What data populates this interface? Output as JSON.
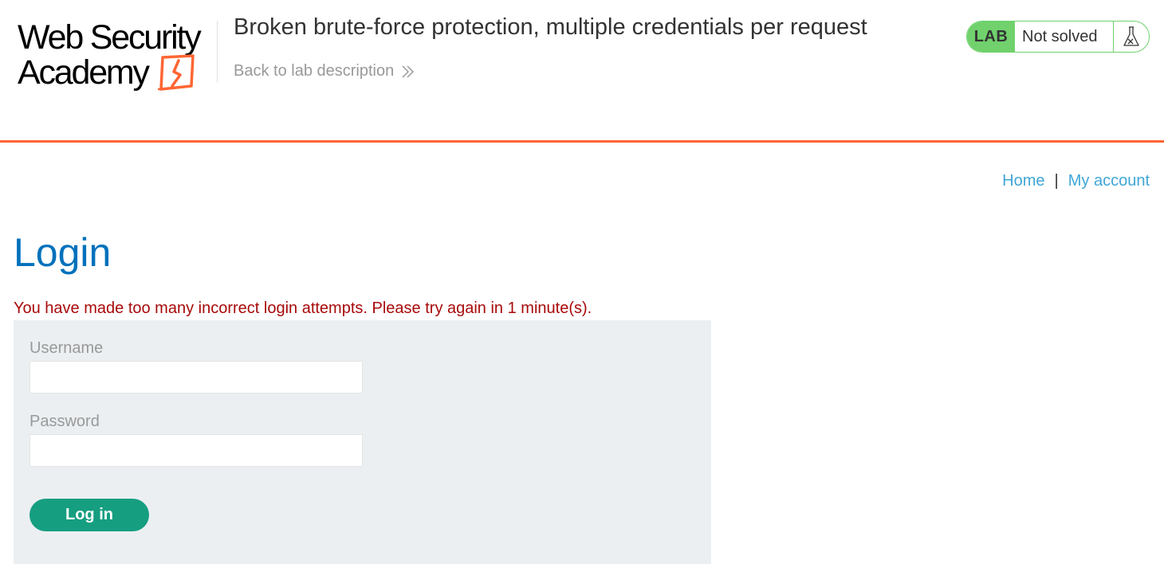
{
  "header": {
    "logo": {
      "line1": "Web Security",
      "line2": "Academy"
    },
    "lab_title": "Broken brute-force protection, multiple credentials per request",
    "back_link": "Back to lab description",
    "lab_status": {
      "badge": "LAB",
      "state": "Not solved"
    }
  },
  "nav": {
    "home": "Home",
    "separator": "|",
    "my_account": "My account"
  },
  "login": {
    "title": "Login",
    "error": "You have made too many incorrect login attempts. Please try again in 1 minute(s).",
    "username_label": "Username",
    "username_value": "",
    "password_label": "Password",
    "password_value": "",
    "submit_label": "Log in"
  },
  "colors": {
    "accent_orange": "#ff6633",
    "title_blue": "#0071bc",
    "link_blue": "#3fa6d6",
    "status_green": "#70d16d",
    "button_teal": "#159e80",
    "error_red": "#a80a0a",
    "panel_gray": "#ebeff2"
  },
  "icons": {
    "logo_mark": "lightning-box-icon",
    "back_link_arrow": "double-chevron-right-icon",
    "lab_status": "flask-icon"
  }
}
